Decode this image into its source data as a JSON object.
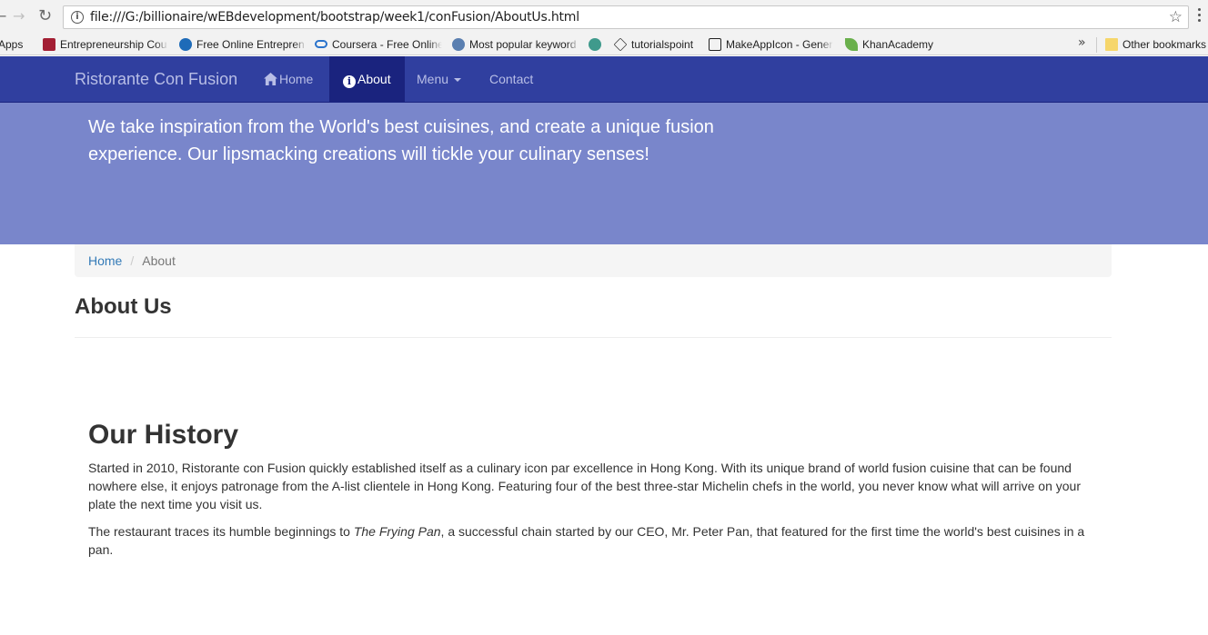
{
  "browser": {
    "back_glyph": "←",
    "forward_glyph": "→",
    "reload_glyph": "↻",
    "info_glyph": "i",
    "url": "file:///G:/billionaire/wEBdevelopment/bootstrap/week1/conFusion/AboutUs.html",
    "star_glyph": "☆",
    "bookmarks": [
      {
        "label": "Apps",
        "icon": "apps-grid-icon",
        "color": "#4a8af4"
      },
      {
        "label": "Entrepreneurship Cou",
        "icon": "mit-logo-icon",
        "color": "#a31f34"
      },
      {
        "label": "Free Online Entrepren",
        "icon": "globe-icon",
        "color": "#1e6bb8"
      },
      {
        "label": "Coursera - Free Online",
        "icon": "coursera-icon",
        "color": "#2a73cc"
      },
      {
        "label": "Most popular keyword",
        "icon": "keyword-icon",
        "color": "#5a7fb0"
      },
      {
        "label": "",
        "icon": "t-circle-icon",
        "color": "#3f9a8c"
      },
      {
        "label": "tutorialspoint",
        "icon": "tutorialspoint-icon",
        "color": "#333333"
      },
      {
        "label": "MakeAppIcon - Gener",
        "icon": "makeappicon-icon",
        "color": "#222222"
      },
      {
        "label": "KhanAcademy",
        "icon": "leaf-icon",
        "color": "#6ab04c"
      }
    ],
    "more_glyph": "»",
    "other_bookmarks": "Other bookmarks"
  },
  "navbar": {
    "brand": "Ristorante Con Fusion",
    "items": [
      {
        "label": "Home",
        "icon": "home-icon",
        "active": false
      },
      {
        "label": "About",
        "icon": "info-icon",
        "active": true
      },
      {
        "label": "Menu",
        "icon": "caret-down-icon",
        "active": false
      },
      {
        "label": "Contact",
        "icon": "",
        "active": false
      }
    ],
    "colors": {
      "primary": "#303f9f",
      "active": "#1a237e",
      "jumbotron": "#7986cb"
    }
  },
  "jumbotron": {
    "text": "We take inspiration from the World's best cuisines, and create a unique fusion experience. Our lipsmacking creations will tickle your culinary senses!"
  },
  "breadcrumb": {
    "home": "Home",
    "separator": "/",
    "current": "About"
  },
  "page_title": "About Us",
  "history": {
    "title": "Our History",
    "para1": "Started in 2010, Ristorante con Fusion quickly established itself as a culinary icon par excellence in Hong Kong. With its unique brand of world fusion cuisine that can be found nowhere else, it enjoys patronage from the A-list clientele in Hong Kong. Featuring four of the best three-star Michelin chefs in the world, you never know what will arrive on your plate the next time you visit us.",
    "para2_before": "The restaurant traces its humble beginnings to ",
    "para2_em": "The Frying Pan",
    "para2_after": ", a successful chain started by our CEO, Mr. Peter Pan, that featured for the first time the world's best cuisines in a pan."
  }
}
